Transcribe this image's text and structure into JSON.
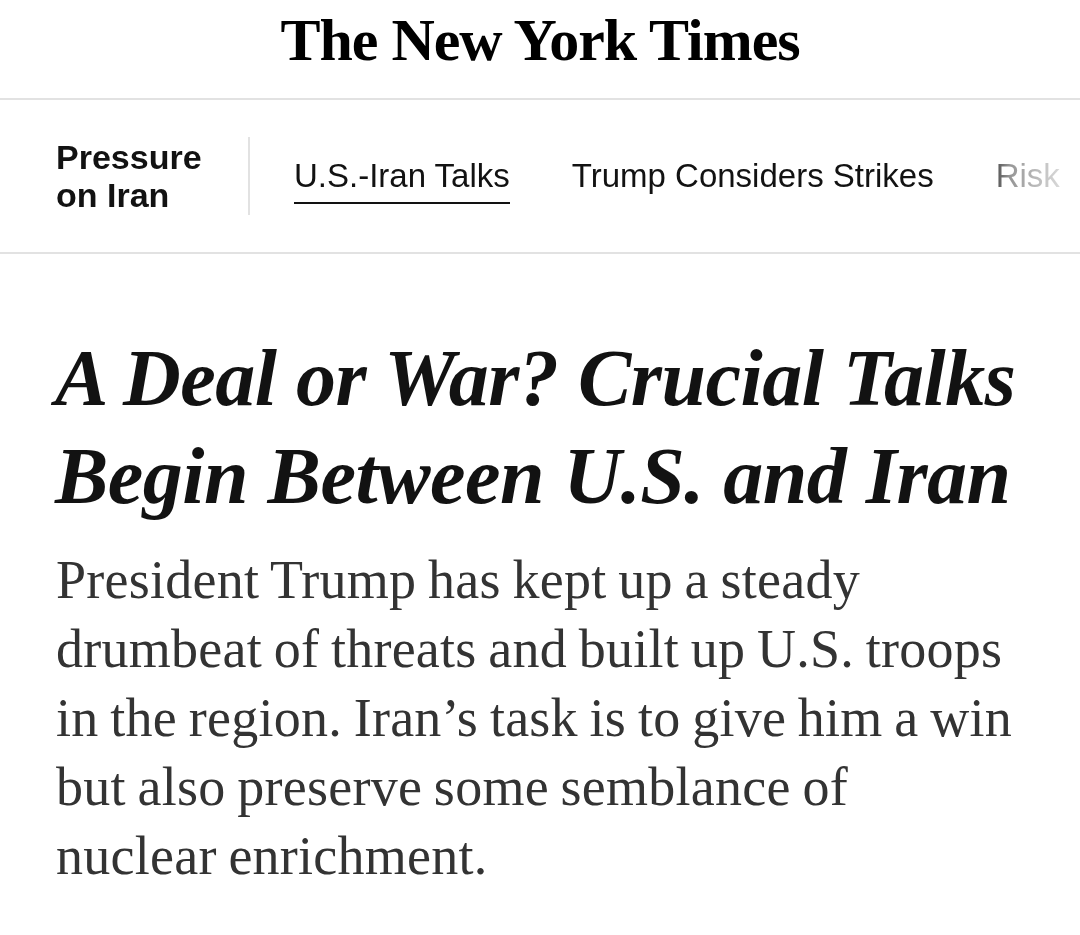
{
  "masthead": {
    "title": "The New York Times"
  },
  "section_nav": {
    "label": "Pressure on Iran",
    "tabs": [
      {
        "label": "U.S.-Iran Talks",
        "selected": true
      },
      {
        "label": "Trump Considers Strikes",
        "selected": false
      },
      {
        "label": "Risk",
        "selected": false
      }
    ]
  },
  "article": {
    "headline": "A Deal or War? Crucial Talks Begin Between U.S. and Iran",
    "summary": "President Trump has kept up a steady drumbeat of threats and built up U.S. troops in the region. Iran’s task is to give him a win but also preserve some semblance of nuclear enrichment."
  }
}
